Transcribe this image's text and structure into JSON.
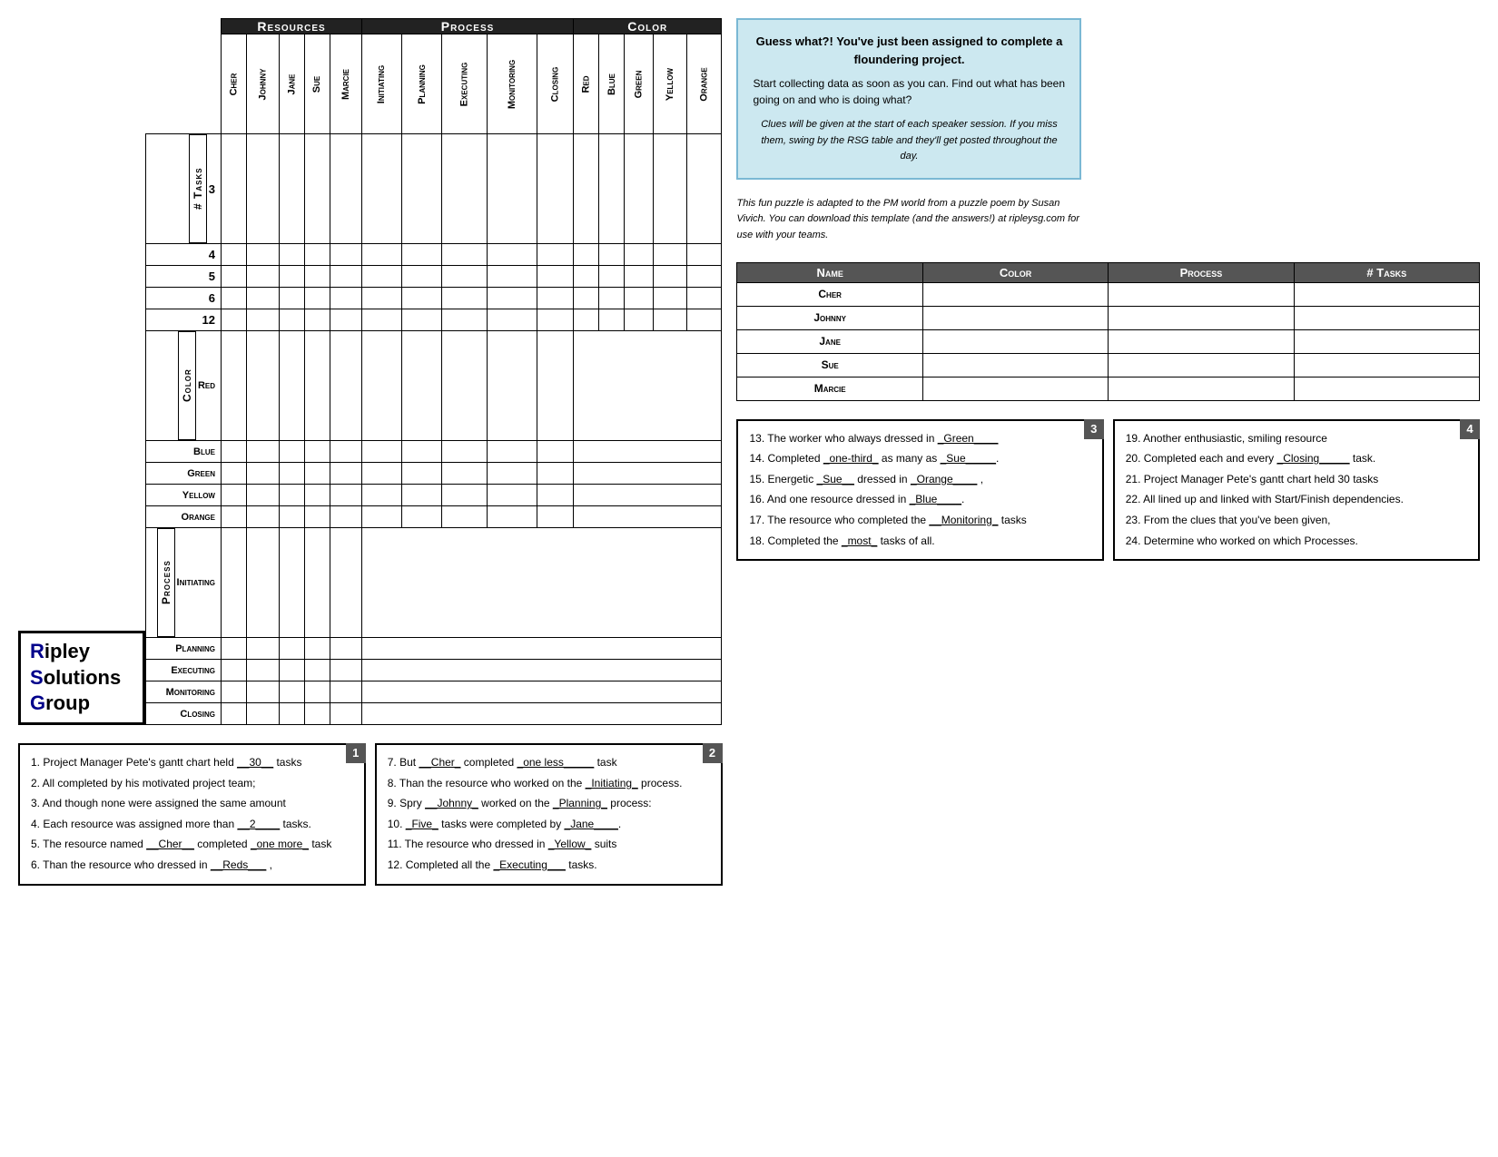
{
  "logo": {
    "line1": "ipley",
    "line2": "olutions",
    "line3": "roup"
  },
  "headers": {
    "resources": "Resources",
    "process": "Process",
    "color": "Color"
  },
  "columns": {
    "resources": [
      "Cher",
      "Johnny",
      "Jane",
      "Sue",
      "Marcie"
    ],
    "process": [
      "Initiating",
      "Planning",
      "Executing",
      "Monitoring",
      "Closing"
    ],
    "color": [
      "Red",
      "Blue",
      "Green",
      "Yellow",
      "Orange"
    ]
  },
  "rows": {
    "tasks": [
      "3",
      "4",
      "5",
      "6",
      "12"
    ],
    "color": [
      "Red",
      "Blue",
      "Green",
      "Yellow",
      "Orange"
    ],
    "process": [
      "Initiating",
      "Planning",
      "Executing",
      "Monitoring",
      "Closing"
    ]
  },
  "answer_table": {
    "headers": [
      "Name",
      "Color",
      "Process",
      "# Tasks"
    ],
    "rows": [
      "Cher",
      "Johnny",
      "Jane",
      "Sue",
      "Marcie"
    ]
  },
  "info_box": {
    "title": "Guess what?! You've just been assigned to complete a floundering project.",
    "main_text": "Start collecting data as soon as you can.  Find out what has been going on and who is doing what?",
    "subtitle": "Clues will be given at the start of each speaker session.  If you miss them, swing by the RSG table and they'll get posted throughout the day."
  },
  "credit_text": "This fun puzzle is adapted to the PM world from a puzzle poem by Susan Vivich.  You can download this template (and the answers!) at ripleysg.com for use with your teams.",
  "clues": {
    "box1": {
      "number": "1",
      "lines": [
        "1.  Project Manager Pete's gantt chart held __30__ tasks",
        "2.  All completed by his motivated project team;",
        "3.  And though none were assigned the same amount",
        "4.  Each resource was assigned more than __2____ tasks.",
        "5.  The resource named __Cher__ completed _one more_ task",
        "6.  Than the resource who dressed in __Reds___ ,"
      ]
    },
    "box2": {
      "number": "2",
      "lines": [
        "7.  But __Cher_ completed _one less_____ task",
        "8.  Than the resource who worked on the _Initiating_ process.",
        "9.  Spry __Johnny_ worked on the _Planning_ process:",
        "10. _Five_ tasks were completed by _Jane____.",
        "11. The resource who dressed in _Yellow_ suits",
        "12. Completed all the _Executing___ tasks."
      ]
    },
    "box3": {
      "number": "3",
      "lines": [
        "13. The worker who always dressed in _Green____",
        "14. Completed _one-third_ as many as _Sue_____.",
        "15. Energetic _Sue__ dressed in _Orange____ ,",
        "16. And one resource dressed in _Blue____.",
        "17. The resource who completed the __Monitoring_ tasks",
        "18. Completed the _most_ tasks of all."
      ]
    },
    "box4": {
      "number": "4",
      "lines": [
        "19. Another enthusiastic, smiling resource",
        "20. Completed each and every _Closing_____ task.",
        "21. Project Manager Pete's gantt chart held 30 tasks",
        "22. All lined up and linked with Start/Finish dependencies.",
        "23. From the clues that you've been given,",
        "24. Determine who worked on which Processes."
      ]
    }
  }
}
